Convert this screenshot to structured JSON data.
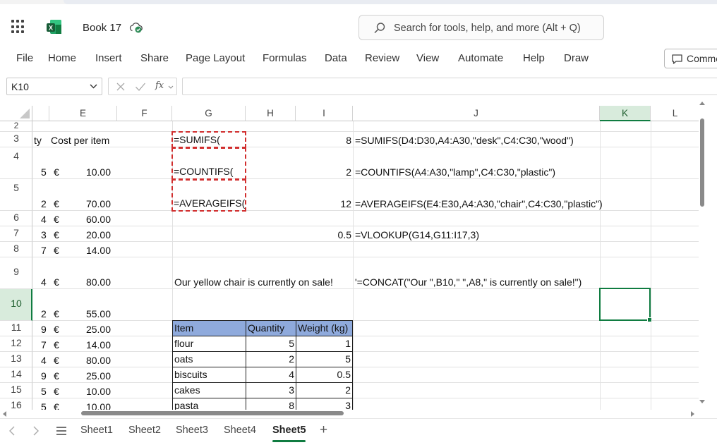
{
  "app": {
    "title": "Book 17",
    "search_placeholder": "Search for tools, help, and more (Alt + Q)",
    "comments_label": "Comments",
    "accent_color": "#107c41"
  },
  "menu": [
    "File",
    "Home",
    "Insert",
    "Share",
    "Page Layout",
    "Formulas",
    "Data",
    "Review",
    "View",
    "Automate",
    "Help",
    "Draw"
  ],
  "formula_bar": {
    "name_box": "K10",
    "fx_label": "fx",
    "formula": ""
  },
  "columns": [
    "",
    "E",
    "F",
    "G",
    "H",
    "I",
    "J",
    "K",
    "L"
  ],
  "selected_column": "K",
  "rows": [
    "2",
    "3",
    "4",
    "5",
    "6",
    "7",
    "8",
    "9",
    "10",
    "11",
    "12",
    "13",
    "14",
    "15",
    "16"
  ],
  "selected_row": "10",
  "cells": {
    "r3_d": "ty",
    "r3_e": "Cost per item",
    "r3_g": "=SUMIFS(",
    "r3_i": "8",
    "r3_j": "=SUMIFS(D4:D30,A4:A30,\"desk\",C4:C30,\"wood\")",
    "r4_d": "5",
    "r4_eur": "€",
    "r4_e": "10.00",
    "r4_g": "=COUNTIFS(",
    "r4_i": "2",
    "r4_j": "=COUNTIFS(A4:A30,\"lamp\",C4:C30,\"plastic\")",
    "r5_d": "2",
    "r5_eur": "€",
    "r5_e": "70.00",
    "r5_g": "=AVERAGEIFS(",
    "r5_i": "12",
    "r5_j": "=AVERAGEIFS(E4:E30,A4:A30,\"chair\",C4:C30,\"plastic\")",
    "r6_d": "4",
    "r6_eur": "€",
    "r6_e": "60.00",
    "r7_d": "3",
    "r7_eur": "€",
    "r7_e": "20.00",
    "r7_i": "0.5",
    "r7_j": "=VLOOKUP(G14,G11:I17,3)",
    "r8_d": "7",
    "r8_eur": "€",
    "r8_e": "14.00",
    "r9_d": "4",
    "r9_eur": "€",
    "r9_e": "80.00",
    "r9_g": "Our yellow chair is currently on sale!",
    "r9_j": "'=CONCAT(\"Our \",B10,\" \",A8,\" is currently on sale!\")",
    "r10_d": "2",
    "r10_eur": "€",
    "r10_e": "55.00",
    "r11_d": "9",
    "r11_eur": "€",
    "r11_e": "25.00",
    "r12_d": "7",
    "r12_eur": "€",
    "r12_e": "14.00",
    "r13_d": "4",
    "r13_eur": "€",
    "r13_e": "80.00",
    "r14_d": "9",
    "r14_eur": "€",
    "r14_e": "25.00",
    "r15_d": "5",
    "r15_eur": "€",
    "r15_e": "10.00",
    "r16_d": "5",
    "r16_eur": "€",
    "r16_e": "10.00"
  },
  "lookup_table": {
    "headers": [
      "Item",
      "Quantity",
      "Weight (kg)"
    ],
    "rows": [
      [
        "flour",
        "5",
        "1"
      ],
      [
        "oats",
        "2",
        "5"
      ],
      [
        "biscuits",
        "4",
        "0.5"
      ],
      [
        "cakes",
        "3",
        "2"
      ],
      [
        "pasta",
        "8",
        "3"
      ]
    ],
    "header_color": "#8faadc"
  },
  "sheets": [
    "Sheet1",
    "Sheet2",
    "Sheet3",
    "Sheet4",
    "Sheet5"
  ],
  "active_sheet": "Sheet5",
  "add_sheet_label": "+"
}
